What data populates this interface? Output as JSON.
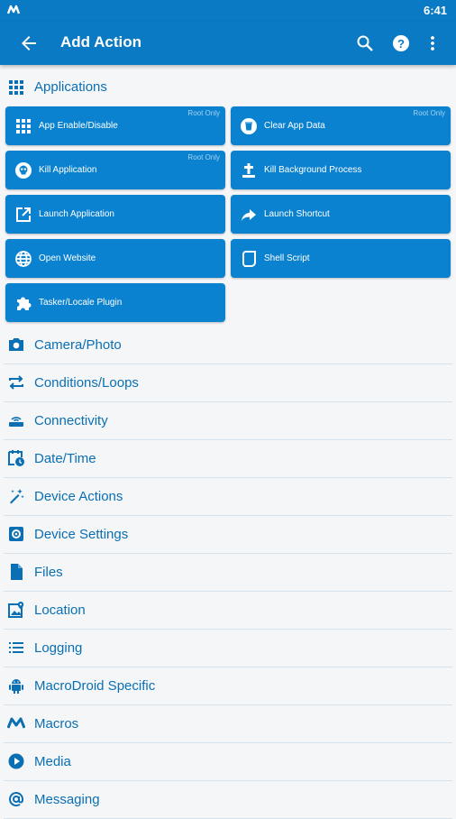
{
  "status": {
    "time": "6:41"
  },
  "appbar": {
    "title": "Add Action"
  },
  "applications": {
    "title": "Applications",
    "tiles": [
      {
        "label": "App Enable/Disable",
        "badge": "Root Only",
        "icon": "grid-icon"
      },
      {
        "label": "Clear App Data",
        "badge": "Root Only",
        "icon": "trash-icon"
      },
      {
        "label": "Kill Application",
        "badge": "Root Only",
        "icon": "skull-icon"
      },
      {
        "label": "Kill Background Process",
        "badge": "",
        "icon": "grave-cross-icon"
      },
      {
        "label": "Launch Application",
        "badge": "",
        "icon": "open-external-icon"
      },
      {
        "label": "Launch Shortcut",
        "badge": "",
        "icon": "share-arrow-icon"
      },
      {
        "label": "Open Website",
        "badge": "",
        "icon": "globe-icon"
      },
      {
        "label": "Shell Script",
        "badge": "",
        "icon": "script-icon"
      },
      {
        "label": "Tasker/Locale Plugin",
        "badge": "",
        "icon": "puzzle-icon"
      }
    ]
  },
  "categories": [
    {
      "label": "Camera/Photo",
      "icon": "camera-icon"
    },
    {
      "label": "Conditions/Loops",
      "icon": "repeat-icon"
    },
    {
      "label": "Connectivity",
      "icon": "router-icon"
    },
    {
      "label": "Date/Time",
      "icon": "calendar-clock-icon"
    },
    {
      "label": "Device Actions",
      "icon": "magic-wand-icon"
    },
    {
      "label": "Device Settings",
      "icon": "settings-box-icon"
    },
    {
      "label": "Files",
      "icon": "file-icon"
    },
    {
      "label": "Location",
      "icon": "map-pin-icon"
    },
    {
      "label": "Logging",
      "icon": "list-icon"
    },
    {
      "label": "MacroDroid Specific",
      "icon": "android-icon"
    },
    {
      "label": "Macros",
      "icon": "macrodroid-logo-icon"
    },
    {
      "label": "Media",
      "icon": "play-circle-icon"
    },
    {
      "label": "Messaging",
      "icon": "at-sign-icon"
    }
  ],
  "colors": {
    "primary": "#0a7ac4",
    "tile": "#0a82d0",
    "label": "#0a6fb3",
    "background": "#f5f6f8"
  }
}
